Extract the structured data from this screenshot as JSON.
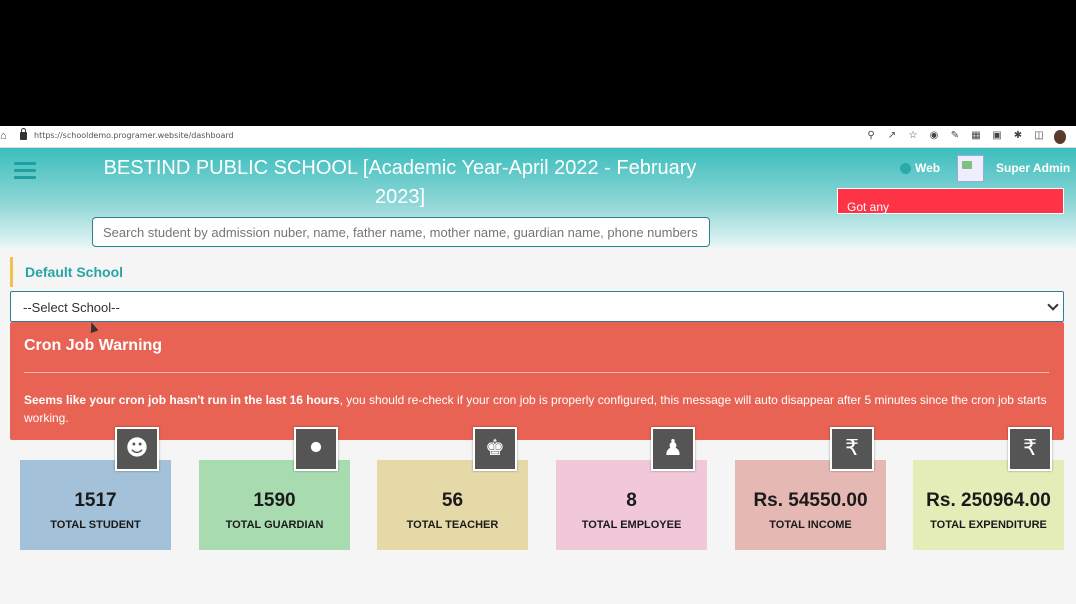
{
  "browser": {
    "url": "https://schooldemo.programer.website/dashboard"
  },
  "header": {
    "title": "BESTIND PUBLIC SCHOOL [Academic Year-April 2022 - February 2023]",
    "web_label": "Web",
    "admin_name": "Super Admin",
    "toast_text": "Got any",
    "search_placeholder": "Search student by admission nuber, name, father name, mother name, guardian name, phone numbers, st"
  },
  "school": {
    "section_label": "Default School",
    "select_value": "--Select School--"
  },
  "cron": {
    "title": "Cron Job Warning",
    "message_bold": "Seems like your cron job hasn't run in the last 16 hours",
    "message_rest": ", you should re-check if your cron job is properly configured, this message will auto disappear after 5 minutes since the cron job starts working."
  },
  "cards": [
    {
      "value": "1517",
      "label": "TOTAL STUDENT",
      "icon": "child-icon",
      "color": "#a3c1d8"
    },
    {
      "value": "1590",
      "label": "TOTAL GUARDIAN",
      "icon": "user-icon",
      "color": "#a8dcb0"
    },
    {
      "value": "56",
      "label": "TOTAL TEACHER",
      "icon": "users-icon",
      "color": "#e6d9a8"
    },
    {
      "value": "8",
      "label": "TOTAL EMPLOYEE",
      "icon": "male-icon",
      "color": "#f0c8d8"
    },
    {
      "value": "Rs. 54550.00",
      "label": "TOTAL INCOME",
      "icon": "rupee-icon",
      "color": "#e6b8b4"
    },
    {
      "value": "Rs. 250964.00",
      "label": "TOTAL EXPENDITURE",
      "icon": "rupee-icon",
      "color": "#e4ecb8"
    }
  ],
  "colors": {
    "header_teal": "#3bbdbd",
    "warning_red": "#e96354",
    "toast_red": "#ff3346",
    "accent_teal": "#27a5a5"
  }
}
